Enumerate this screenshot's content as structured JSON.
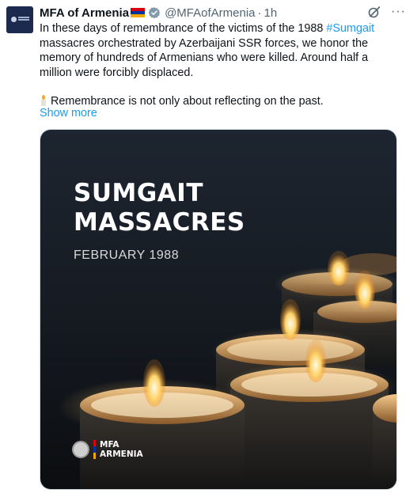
{
  "tweet": {
    "display_name": "MFA of Armenia",
    "handle": "@MFAofArmenia",
    "separator": "·",
    "time": "1h",
    "text_part1": "In these days of remembrance of the victims of the 1988 ",
    "hashtag": "#Sumgait",
    "text_part2": " massacres orchestrated by Azerbaijani SSR forces, we honor the memory of hundreds of Armenians who were killed. Around half a million were forcibly displaced.",
    "text_para2": "Remembrance is not only about reflecting on the past.",
    "show_more": "Show more",
    "more_icon": "···",
    "flag_colors": [
      "#d90012",
      "#0033a0",
      "#f2a800"
    ],
    "verified_color": "#829aab",
    "link_color": "#1d9bf0"
  },
  "media": {
    "title_line1": "SUMGAIT",
    "title_line2": "MASSACRES",
    "subtitle": "FEBRUARY 1988",
    "logo_line1": "MFA",
    "logo_line2": "ARMENIA"
  },
  "icons": {
    "avatar": "mfa-armenia-logo",
    "verified": "verified-badge-icon",
    "grok": "grok-icon",
    "more": "more-options-icon",
    "emoji": "candle-emoji"
  }
}
